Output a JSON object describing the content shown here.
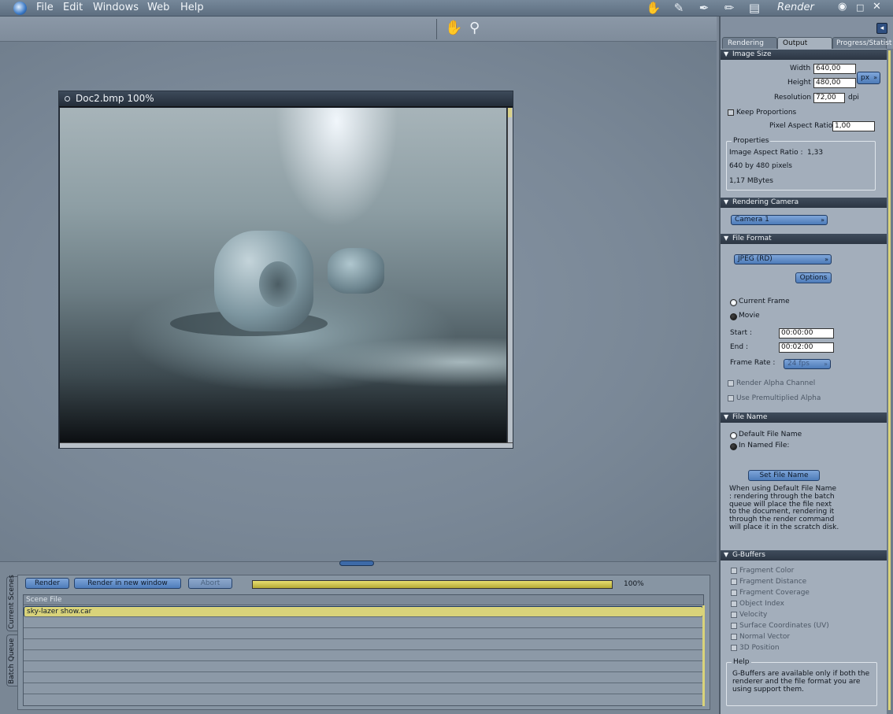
{
  "menu": {
    "items": [
      "File",
      "Edit",
      "Windows",
      "Web",
      "Help"
    ]
  },
  "app": {
    "room_title": "Render"
  },
  "document": {
    "title": "Doc2.bmp 100%"
  },
  "render_controls": {
    "render_label": "Render",
    "render_new_window_label": "Render in new window",
    "abort_label": "Abort",
    "progress": 1.0,
    "progress_label": "100%"
  },
  "side_tabs": {
    "current_scenes": "Current Scenes",
    "batch_queue": "Batch Queue"
  },
  "scene_table": {
    "header": "Scene File",
    "rows": [
      "sky-lazer show.car",
      "",
      "",
      "",
      "",
      "",
      "",
      "",
      ""
    ]
  },
  "panel": {
    "tabs": [
      "Rendering",
      "Output",
      "Progress/Statist"
    ],
    "image_size": {
      "title": "Image Size",
      "width_label": "Width :",
      "width_value": "640,00",
      "height_label": "Height :",
      "height_value": "480,00",
      "unit": "px",
      "resolution_label": "Resolution :",
      "resolution_value": "72,00",
      "resolution_unit": "dpi",
      "keep_proportions_label": "Keep Proportions",
      "pixel_aspect_label": "Pixel Aspect Ratio :",
      "pixel_aspect_value": "1,00",
      "properties_title": "Properties",
      "image_aspect_label": "Image Aspect Ratio :",
      "image_aspect_value": "1,33",
      "pixels_text": "640 by 480 pixels",
      "size_text": "1,17 MBytes"
    },
    "rendering_camera": {
      "title": "Rendering Camera",
      "camera": "Camera 1"
    },
    "file_format": {
      "title": "File Format",
      "format": "JPEG (RD)",
      "options_label": "Options",
      "current_frame_label": "Current Frame",
      "movie_label": "Movie",
      "start_label": "Start :",
      "start_value": "00:00:00",
      "end_label": "End :",
      "end_value": "00:02:00",
      "frame_rate_label": "Frame Rate :",
      "frame_rate_value": "24 fps",
      "alpha_label": "Render Alpha Channel",
      "premult_label": "Use Premultiplied Alpha"
    },
    "file_name": {
      "title": "File Name",
      "default_label": "Default File Name",
      "named_label": "In Named File:",
      "set_label": "Set File Name",
      "note": "When using Default File Name : rendering through the batch queue will place the file next to the document, rendering it through the render command will place it in the scratch disk."
    },
    "gbuffers": {
      "title": "G-Buffers",
      "items": [
        "Fragment Color",
        "Fragment Distance",
        "Fragment Coverage",
        "Object Index",
        "Velocity",
        "Surface Coordinates (UV)",
        "Normal Vector",
        "3D Position"
      ],
      "help_title": "Help",
      "help_text": "G-Buffers are available only if both the renderer and the file format you are using support them."
    }
  }
}
